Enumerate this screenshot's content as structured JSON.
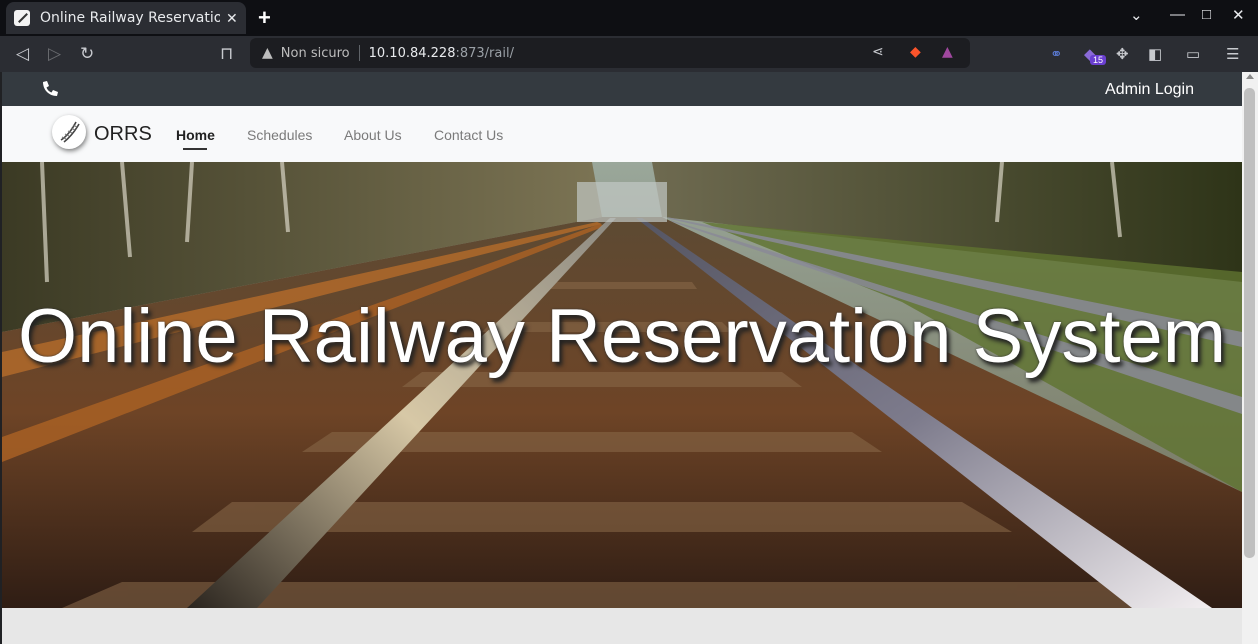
{
  "browser": {
    "tab_title": "Online Railway Reservation System",
    "url_warning": "Non sicuro",
    "url_host": "10.10.84.228",
    "url_path": ":873/rail/",
    "extension_badge": "15"
  },
  "topbar": {
    "admin_login": "Admin Login"
  },
  "navbar": {
    "brand": "ORRS",
    "links": [
      "Home",
      "Schedules",
      "About Us",
      "Contact Us"
    ]
  },
  "hero": {
    "title": "Online Railway Reservation System"
  }
}
